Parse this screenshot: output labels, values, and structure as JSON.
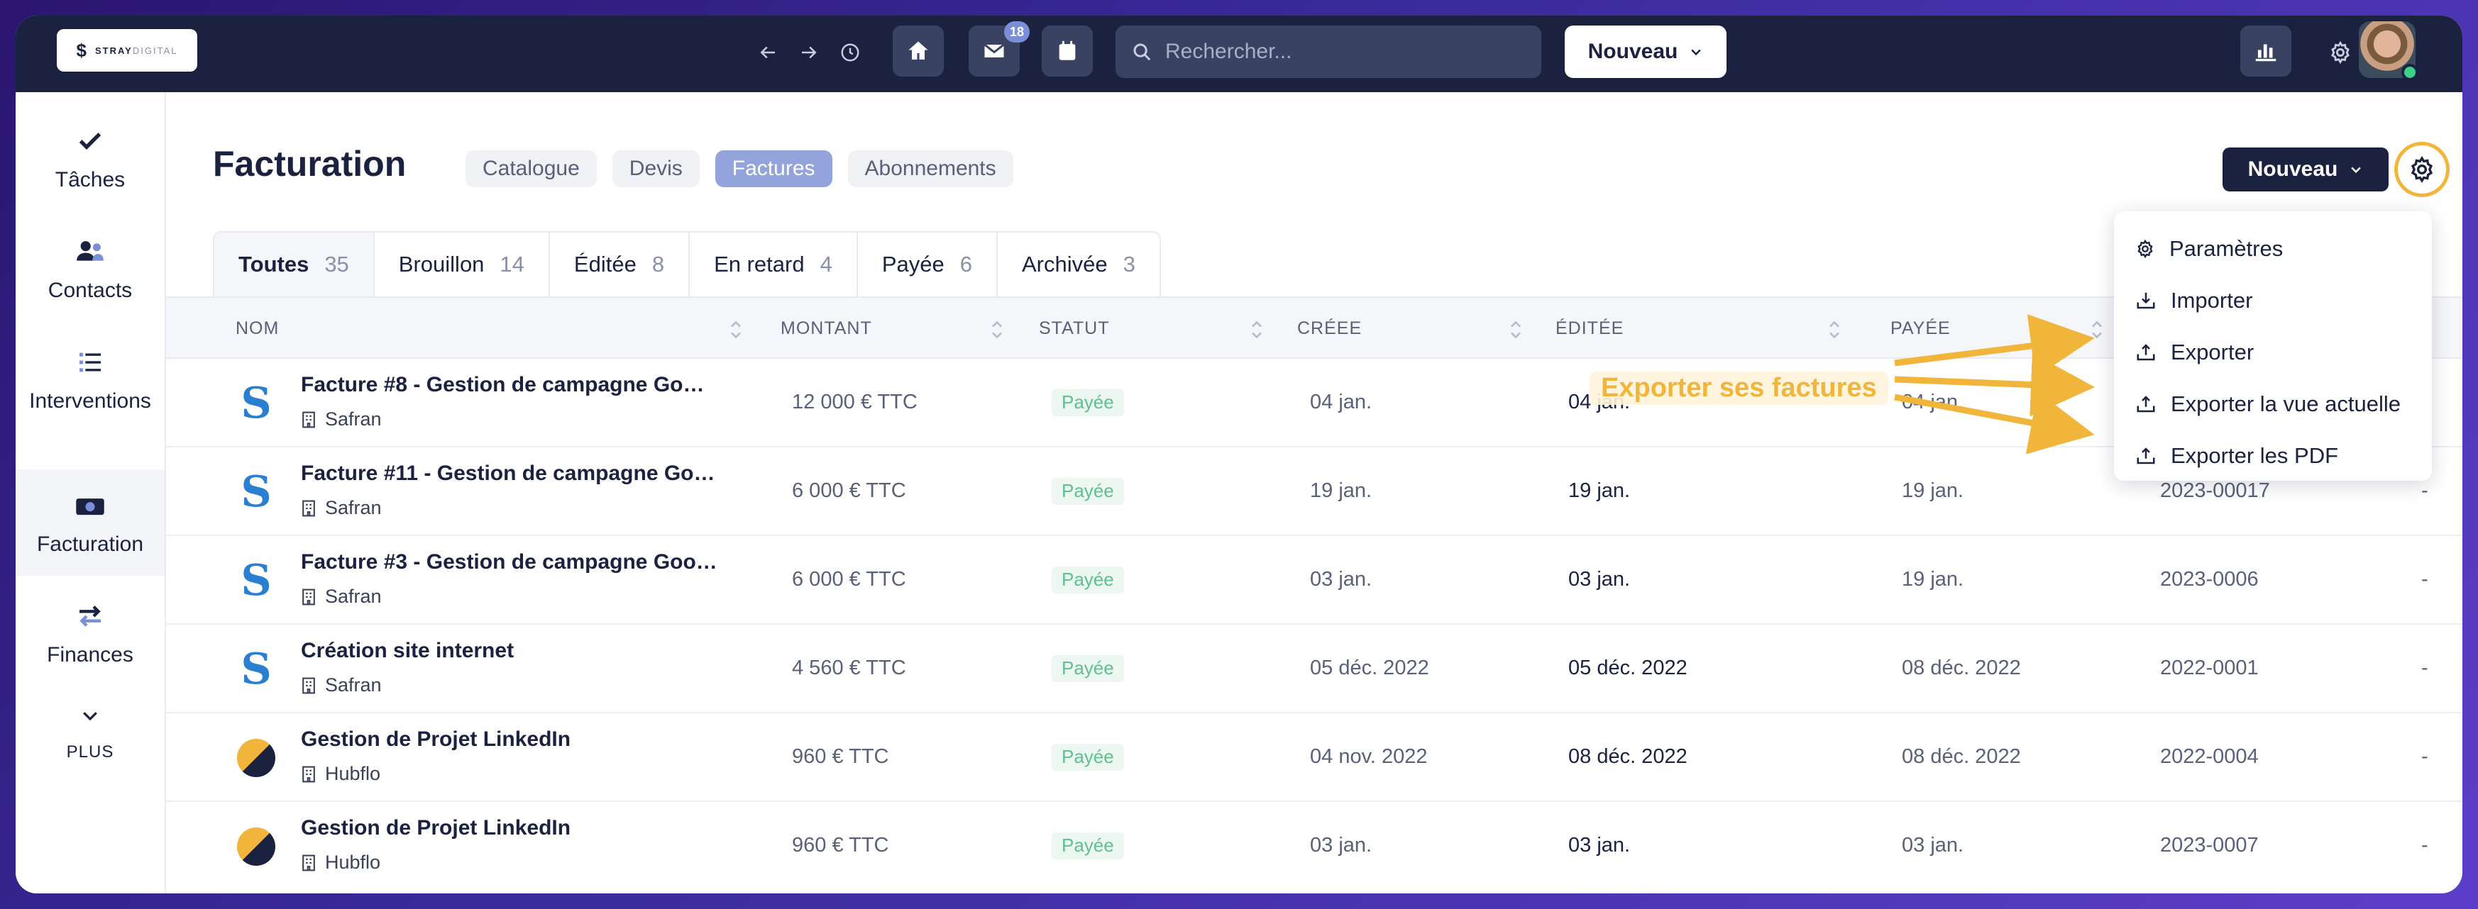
{
  "topbar": {
    "logo_text": "STRAYDIGITAL",
    "logo_strong": "STRAY",
    "logo_light": "DIGITAL",
    "messages_badge": "18",
    "search_placeholder": "Rechercher...",
    "new_label": "Nouveau",
    "icons": [
      "back-arrow-icon",
      "forward-arrow-icon",
      "history-icon",
      "home-icon",
      "mail-icon",
      "calendar-icon",
      "search-icon",
      "chevron-down-icon",
      "stats-icon",
      "gear-icon"
    ]
  },
  "sidebar": {
    "items": [
      {
        "label": "Tâches",
        "icon": "check-icon"
      },
      {
        "label": "Contacts",
        "icon": "contacts-icon"
      },
      {
        "label": "Interventions",
        "icon": "list-icon"
      },
      {
        "label": "Facturation",
        "icon": "invoice-icon"
      },
      {
        "label": "Finances",
        "icon": "transfer-icon"
      },
      {
        "label": "PLUS",
        "icon": "chevron-down-icon"
      }
    ]
  },
  "header": {
    "title": "Facturation",
    "tabs": [
      {
        "label": "Catalogue"
      },
      {
        "label": "Devis"
      },
      {
        "label": "Factures"
      },
      {
        "label": "Abonnements"
      }
    ],
    "active_tab": "Factures",
    "new_label": "Nouveau"
  },
  "filters": [
    {
      "label": "Toutes",
      "count": "35"
    },
    {
      "label": "Brouillon",
      "count": "14"
    },
    {
      "label": "Éditée",
      "count": "8"
    },
    {
      "label": "En retard",
      "count": "4"
    },
    {
      "label": "Payée",
      "count": "6"
    },
    {
      "label": "Archivée",
      "count": "3"
    }
  ],
  "table": {
    "columns": [
      "NOM",
      "MONTANT",
      "STATUT",
      "CRÉEE",
      "ÉDITÉE",
      "PAYÉE"
    ],
    "rows": [
      {
        "name": "Facture #8 - Gestion de campagne Go…",
        "client": "Safran",
        "amount": "12 000 € TTC",
        "status": "Payée",
        "created": "04 jan.",
        "edited": "04 jan.",
        "paid": "04 jan.",
        "ref": "",
        "extra": "",
        "logo": "s"
      },
      {
        "name": "Facture #11 - Gestion de campagne Go…",
        "client": "Safran",
        "amount": "6 000 € TTC",
        "status": "Payée",
        "created": "19 jan.",
        "edited": "19 jan.",
        "paid": "19 jan.",
        "ref": "2023-00017",
        "extra": "-",
        "logo": "s"
      },
      {
        "name": "Facture #3 - Gestion de campagne Goo…",
        "client": "Safran",
        "amount": "6 000 € TTC",
        "status": "Payée",
        "created": "03 jan.",
        "edited": "03 jan.",
        "paid": "19 jan.",
        "ref": "2023-0006",
        "extra": "-",
        "logo": "s"
      },
      {
        "name": "Création site internet",
        "client": "Safran",
        "amount": "4 560 € TTC",
        "status": "Payée",
        "created": "05 déc. 2022",
        "edited": "05 déc. 2022",
        "paid": "08 déc. 2022",
        "ref": "2022-0001",
        "extra": "-",
        "logo": "s"
      },
      {
        "name": "Gestion de Projet LinkedIn",
        "client": "Hubflo",
        "amount": "960 € TTC",
        "status": "Payée",
        "created": "04 nov. 2022",
        "edited": "08 déc. 2022",
        "paid": "08 déc. 2022",
        "ref": "2022-0004",
        "extra": "-",
        "logo": "h"
      },
      {
        "name": "Gestion de Projet LinkedIn",
        "client": "Hubflo",
        "amount": "960 € TTC",
        "status": "Payée",
        "created": "03 jan.",
        "edited": "03 jan.",
        "paid": "03 jan.",
        "ref": "2023-0007",
        "extra": "-",
        "logo": "h"
      }
    ]
  },
  "dropdown": {
    "items": [
      {
        "label": "Paramètres",
        "icon": "gear-icon"
      },
      {
        "label": "Importer",
        "icon": "import-icon"
      },
      {
        "label": "Exporter",
        "icon": "export-icon"
      },
      {
        "label": "Exporter la vue actuelle",
        "icon": "export-icon"
      },
      {
        "label": "Exporter les PDF",
        "icon": "export-icon"
      }
    ]
  },
  "annotation": "Exporter ses factures",
  "colors": {
    "navy": "#1b2240",
    "accent": "#93a3dc",
    "highlight": "#f0b53a",
    "paid_green": "#5fc18f"
  }
}
